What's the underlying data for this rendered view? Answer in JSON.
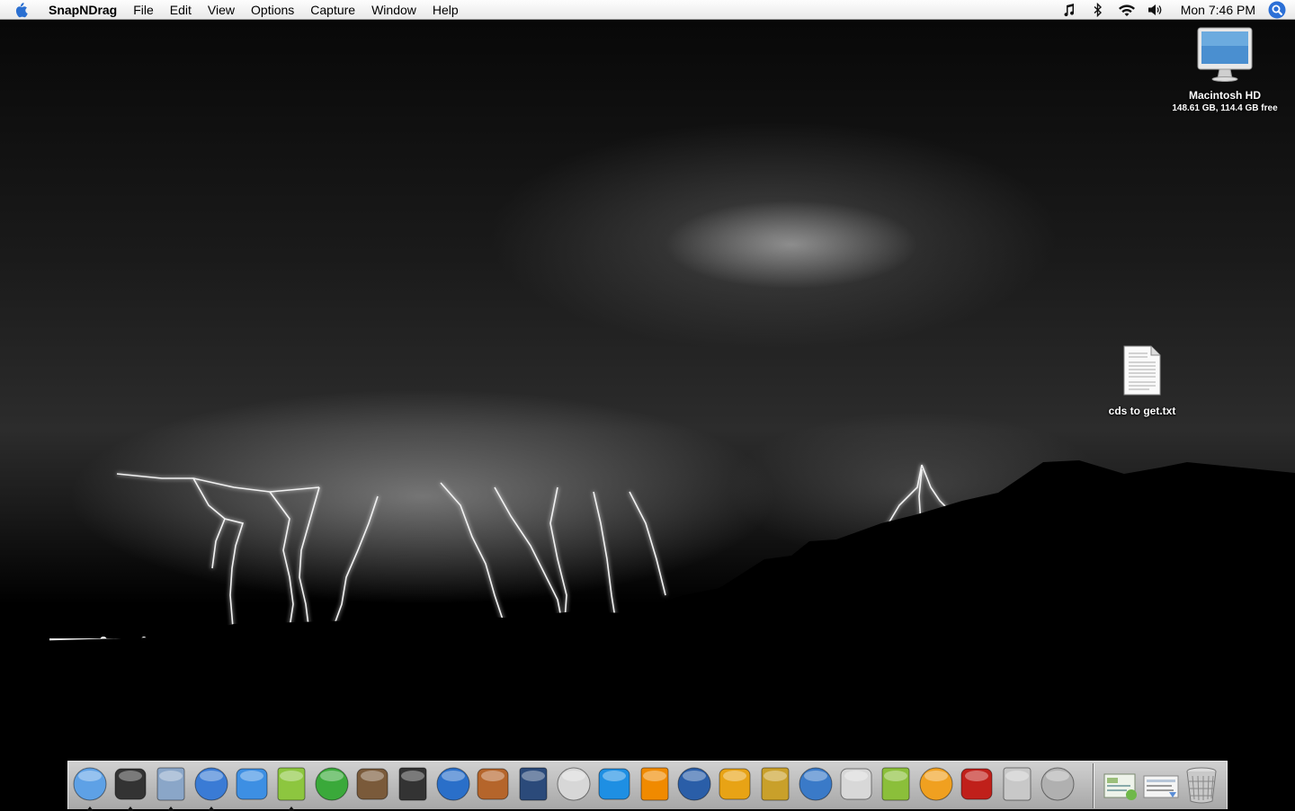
{
  "menubar": {
    "app_name": "SnapNDrag",
    "menus": [
      "File",
      "Edit",
      "View",
      "Options",
      "Capture",
      "Window",
      "Help"
    ],
    "clock": "Mon 7:46 PM",
    "status_icons": [
      "itunes-note-icon",
      "bluetooth-icon",
      "wifi-icon",
      "volume-icon"
    ]
  },
  "desktop": {
    "icons": [
      {
        "name": "Macintosh HD",
        "info": "148.61 GB, 114.4 GB free",
        "icon": "hard-drive-icon"
      },
      {
        "name": "cds to get.txt",
        "icon": "text-document-icon"
      }
    ]
  },
  "dock": {
    "apps": [
      {
        "icon": "finder-icon",
        "color": "#5ea1e6",
        "running": true
      },
      {
        "icon": "dashboard-icon",
        "color": "#333333",
        "running": true
      },
      {
        "icon": "mail-icon",
        "color": "#8aa6c8",
        "running": true
      },
      {
        "icon": "safari-icon",
        "color": "#3a7bd5",
        "running": true
      },
      {
        "icon": "ichat-icon",
        "color": "#3d8fe3",
        "running": false
      },
      {
        "icon": "itunes-icon",
        "color": "#8dc63f",
        "running": true
      },
      {
        "icon": "adium-icon",
        "color": "#3aa93a",
        "running": false
      },
      {
        "icon": "iphoto-icon",
        "color": "#7a5a3a",
        "running": false
      },
      {
        "icon": "imovie-icon",
        "color": "#333333",
        "running": false
      },
      {
        "icon": "idvd-icon",
        "color": "#2a6fc9",
        "running": false
      },
      {
        "icon": "garageband-icon",
        "color": "#b5652b",
        "running": false
      },
      {
        "icon": "camino-icon",
        "color": "#2b4a7a",
        "running": false
      },
      {
        "icon": "dvd-player-icon",
        "color": "#d7d7d7",
        "running": false
      },
      {
        "icon": "quicktime-icon",
        "color": "#1e8fe3",
        "running": false
      },
      {
        "icon": "vlc-icon",
        "color": "#f08a00",
        "running": false
      },
      {
        "icon": "google-earth-icon",
        "color": "#2a5ea8",
        "running": false
      },
      {
        "icon": "burn-icon",
        "color": "#e8a315",
        "running": false
      },
      {
        "icon": "wine-bottler-icon",
        "color": "#c9a02a",
        "running": false
      },
      {
        "icon": "fontforge-icon",
        "color": "#3a7ac8",
        "running": false
      },
      {
        "icon": "textedit-icon",
        "color": "#d8d8d8",
        "running": false
      },
      {
        "icon": "pixelmator-icon",
        "color": "#8bbf3a",
        "running": false
      },
      {
        "icon": "sketch-icon",
        "color": "#f0a020",
        "running": false
      },
      {
        "icon": "photo-booth-icon",
        "color": "#c0201a",
        "running": false
      },
      {
        "icon": "system-profiler-icon",
        "color": "#c8c8c8",
        "running": false
      },
      {
        "icon": "preview-icon",
        "color": "#b0b0b0",
        "running": false
      }
    ],
    "docs": [
      {
        "icon": "documents-stack-icon"
      },
      {
        "icon": "downloads-stack-icon"
      },
      {
        "icon": "trash-icon"
      }
    ]
  }
}
